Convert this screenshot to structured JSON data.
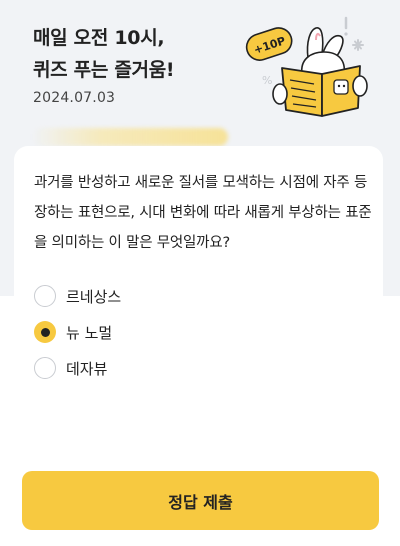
{
  "header": {
    "title_line1": "매일 오전 10시,",
    "title_line2": "퀴즈 푸는 즐거움!",
    "date": "2024.07.03",
    "badge_text": "+10P"
  },
  "quiz": {
    "question": "과거를 반성하고 새로운 질서를 모색하는 시점에 자주 등장하는 표현으로, 시대 변화에 따라 새롭게 부상하는 표준을 의미하는 이 말은 무엇일까요?",
    "options": [
      {
        "label": "르네상스",
        "selected": false
      },
      {
        "label": "뉴 노멀",
        "selected": true
      },
      {
        "label": "데자뷰",
        "selected": false
      }
    ]
  },
  "submit": {
    "label": "정답 제출"
  },
  "colors": {
    "accent": "#f7c940",
    "background": "#f1f3f6",
    "card": "#ffffff"
  }
}
